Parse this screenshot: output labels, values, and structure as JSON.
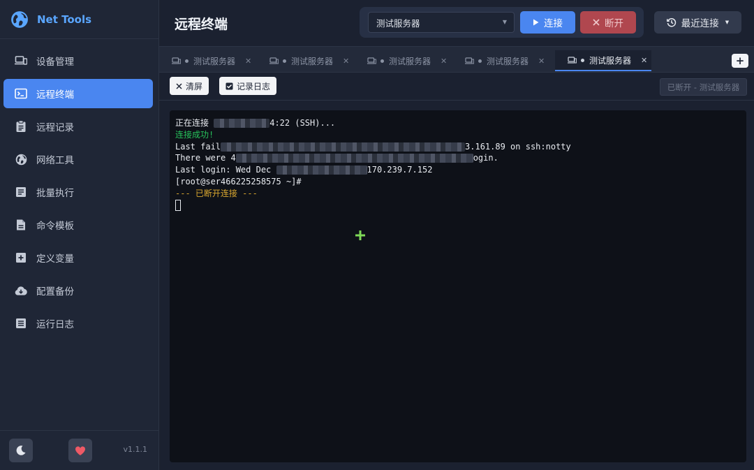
{
  "app": {
    "name": "Net Tools",
    "version": "v1.1.1"
  },
  "sidebar": {
    "items": [
      {
        "label": "设备管理",
        "icon": "devices-icon",
        "active": false
      },
      {
        "label": "远程终端",
        "icon": "terminal-icon",
        "active": true
      },
      {
        "label": "远程记录",
        "icon": "clipboard-icon",
        "active": false
      },
      {
        "label": "网络工具",
        "icon": "globe-icon",
        "active": false
      },
      {
        "label": "批量执行",
        "icon": "list-icon",
        "active": false
      },
      {
        "label": "命令模板",
        "icon": "document-icon",
        "active": false
      },
      {
        "label": "定义变量",
        "icon": "plus-square-icon",
        "active": false
      },
      {
        "label": "配置备份",
        "icon": "cloud-download-icon",
        "active": false
      },
      {
        "label": "运行日志",
        "icon": "log-icon",
        "active": false
      }
    ]
  },
  "header": {
    "title": "远程终端",
    "server_select": "测试服务器",
    "connect_label": "连接",
    "disconnect_label": "断开",
    "recent_label": "最近连接"
  },
  "tabs": [
    {
      "label": "测试服务器",
      "active": false
    },
    {
      "label": "测试服务器",
      "active": false
    },
    {
      "label": "测试服务器",
      "active": false
    },
    {
      "label": "测试服务器",
      "active": false
    },
    {
      "label": "测试服务器",
      "active": true
    }
  ],
  "toolbar": {
    "clear_label": "清屏",
    "log_label": "记录日志",
    "status": "已断开 - 测试服务器"
  },
  "terminal": {
    "lines": {
      "l1a": "正在连接 ",
      "l1b": "4:22 (SSH)...",
      "l2": "连接成功!",
      "l3a": "Last fail",
      "l3b": "3.161.89 on ssh:notty",
      "l4a": "There were 4",
      "l4b": "ogin.",
      "l5a": "Last login: Wed Dec ",
      "l5b": "170.239.7.152",
      "l6": "[root@ser466225258575 ~]#",
      "l7": "--- 已断开连接 ---"
    }
  },
  "colors": {
    "accent": "#4a86f0",
    "danger": "#b0474f",
    "terminal_green": "#27c25b",
    "terminal_orange": "#d9a72f"
  }
}
